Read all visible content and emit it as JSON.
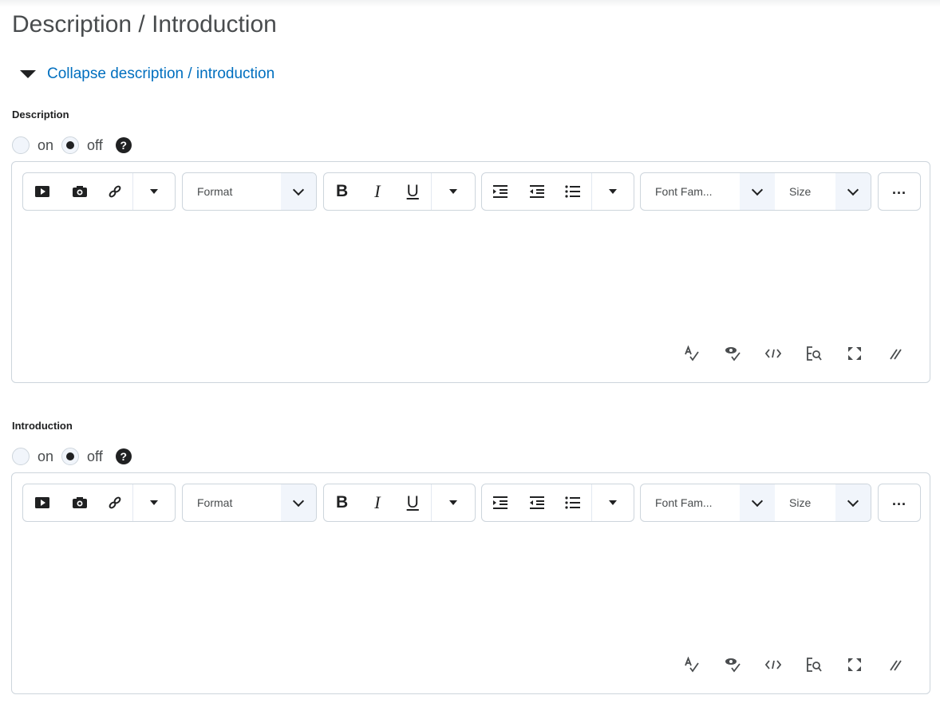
{
  "page": {
    "title": "Description / Introduction",
    "collapse_label": "Collapse description / introduction"
  },
  "sections": [
    {
      "label": "Description",
      "radio_on_label": "on",
      "radio_off_label": "off",
      "selected": "off"
    },
    {
      "label": "Introduction",
      "radio_on_label": "on",
      "radio_off_label": "off",
      "selected": "off"
    }
  ],
  "toolbar": {
    "insert_icons": [
      "insert-video-icon",
      "insert-image-icon",
      "insert-link-icon"
    ],
    "format_placeholder": "Format",
    "text_style_icons": [
      "bold-icon",
      "italic-icon",
      "underline-icon"
    ],
    "list_icons": [
      "indent-icon",
      "outdent-icon",
      "bullet-list-icon"
    ],
    "font_family_placeholder": "Font Fam...",
    "size_placeholder": "Size",
    "more_icon": "more-actions-icon"
  },
  "footer_icons": [
    "spellcheck-icon",
    "accessibility-check-icon",
    "source-code-icon",
    "word-count-icon",
    "fullscreen-icon",
    "resize-handle-icon"
  ],
  "colors": {
    "accent_link": "#006fbf",
    "border": "#cdd5dc",
    "text": "#202122",
    "select_arrow_bg": "#f1f5fb"
  }
}
